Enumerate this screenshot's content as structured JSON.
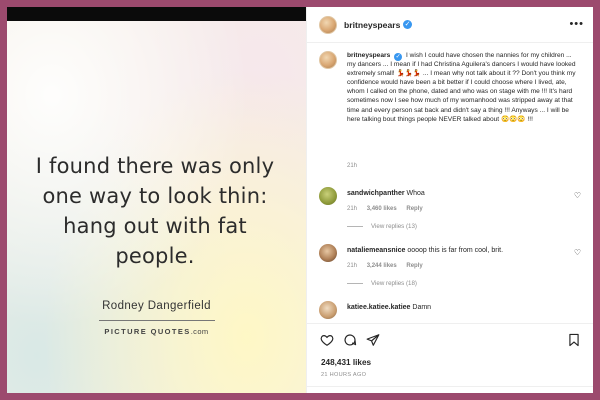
{
  "frame_color": "#9c4a6e",
  "post_image": {
    "quote": "I found there was only one way to look thin: hang out with fat people.",
    "author": "Rodney Dangerfield",
    "brand": "PICTURE QUOTES",
    "brand_domain": ".com"
  },
  "header": {
    "username": "britneyspears",
    "verified_icon": "verified-check-icon",
    "more_icon": "more-options-icon"
  },
  "caption": {
    "username": "britneyspears",
    "text": "I wish I could have chosen the nannies for my children ... my dancers ... I mean if I had Christina Aguilera's dancers I would have looked extremely small! 💃💃💃 ... I mean why not talk about it ?? Don't you think my confidence would have been a bit better if I could choose where I lived, ate, whom I called on the phone, dated and who was on stage with me !!! It's hard sometimes now I see how much of my womanhood was stripped away at that time and every person sat back and didn't say a thing !!! Anyways ... I will be here talking bout things people NEVER talked about 😳😳😳 !!!",
    "time": "21h"
  },
  "comments": [
    {
      "username": "sandwichpanther",
      "text": "Whoa",
      "time": "21h",
      "likes": "3,460 likes",
      "reply": "Reply",
      "view_replies": "View replies (13)"
    },
    {
      "username": "nataliemeansnice",
      "text": "oooop this is far from cool, brit.",
      "time": "21h",
      "likes": "3,244 likes",
      "reply": "Reply",
      "view_replies": "View replies (18)"
    },
    {
      "username": "katiee.katiee.katiee",
      "text": "Damn"
    }
  ],
  "actions": {
    "like_icon": "heart-icon",
    "comment_icon": "comment-icon",
    "share_icon": "share-icon",
    "save_icon": "bookmark-icon"
  },
  "likes": "248,431 likes",
  "post_time": "21 HOURS AGO"
}
